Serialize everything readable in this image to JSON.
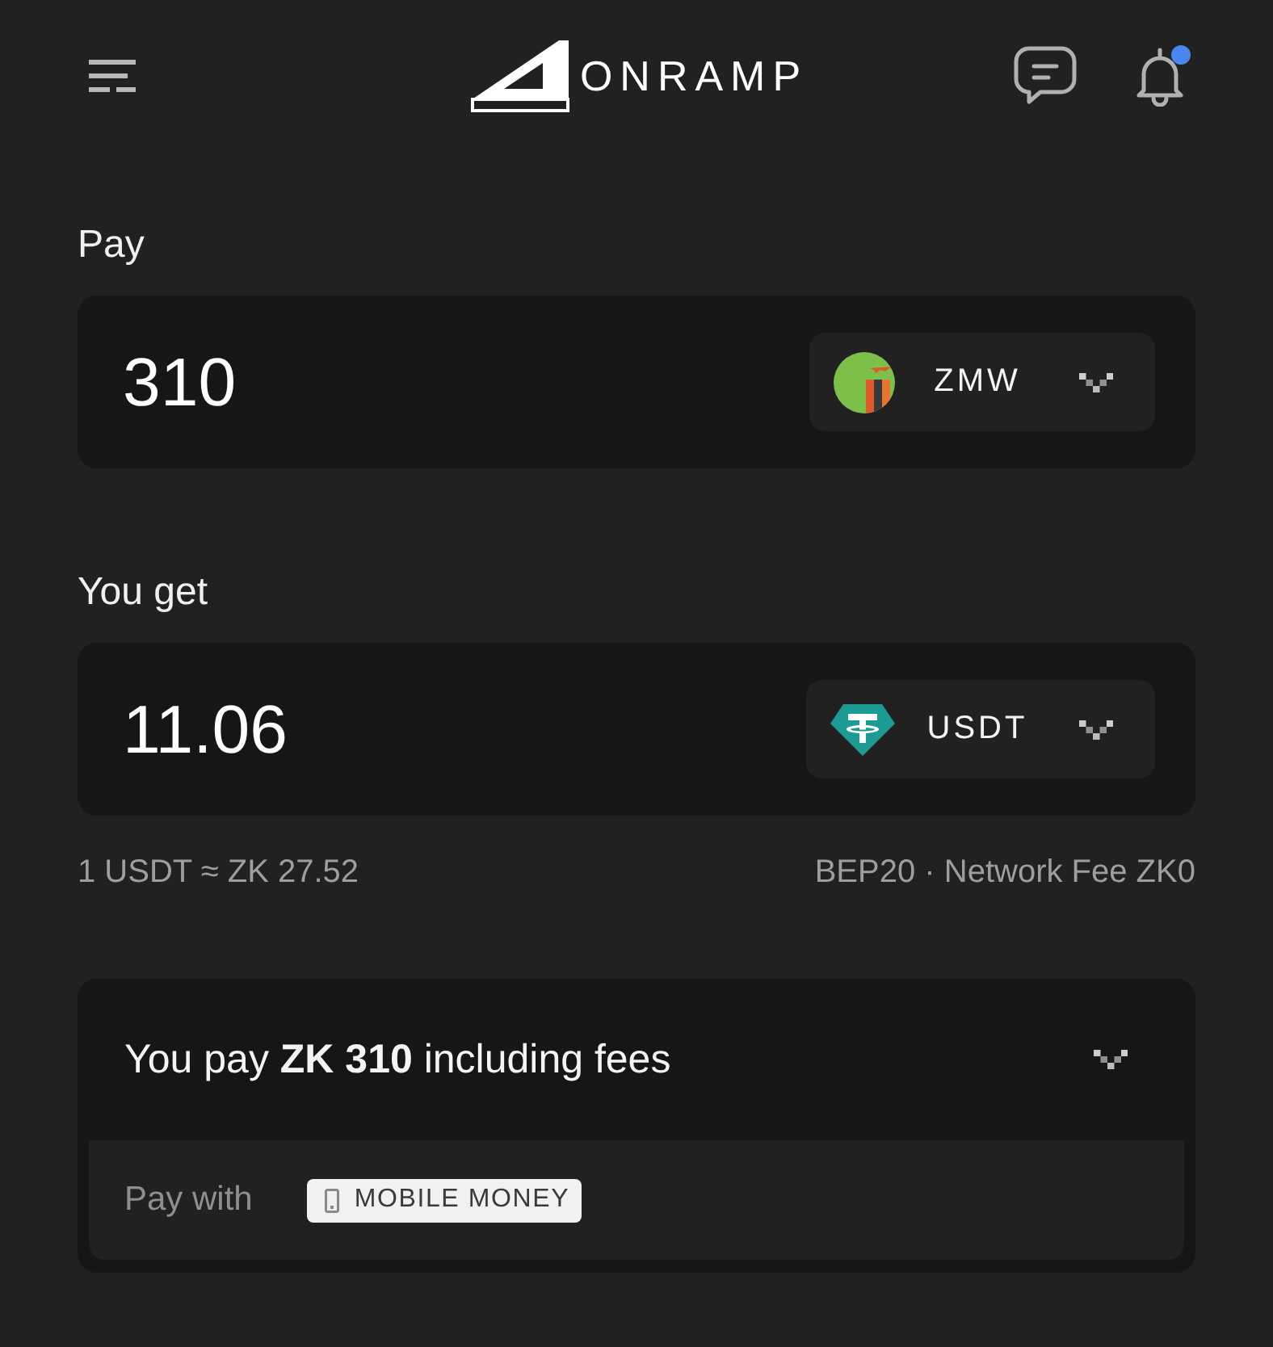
{
  "header": {
    "logo_text": "ONRAMP",
    "notification_badge": true
  },
  "pay": {
    "label": "Pay",
    "amount": "310",
    "currency": {
      "code": "ZMW",
      "kind": "flag"
    }
  },
  "receive": {
    "label": "You get",
    "amount": "11.06",
    "currency": {
      "code": "USDT",
      "kind": "token"
    }
  },
  "rate": {
    "exchange_rate": "1 USDT ≈ ZK 27.52",
    "network_fee": "BEP20 · Network Fee ZK0"
  },
  "summary": {
    "text": "You pay **ZK 310** including fees",
    "expanded": true,
    "pay_with_label": "Pay with",
    "method": "MOBILE MONEY"
  }
}
